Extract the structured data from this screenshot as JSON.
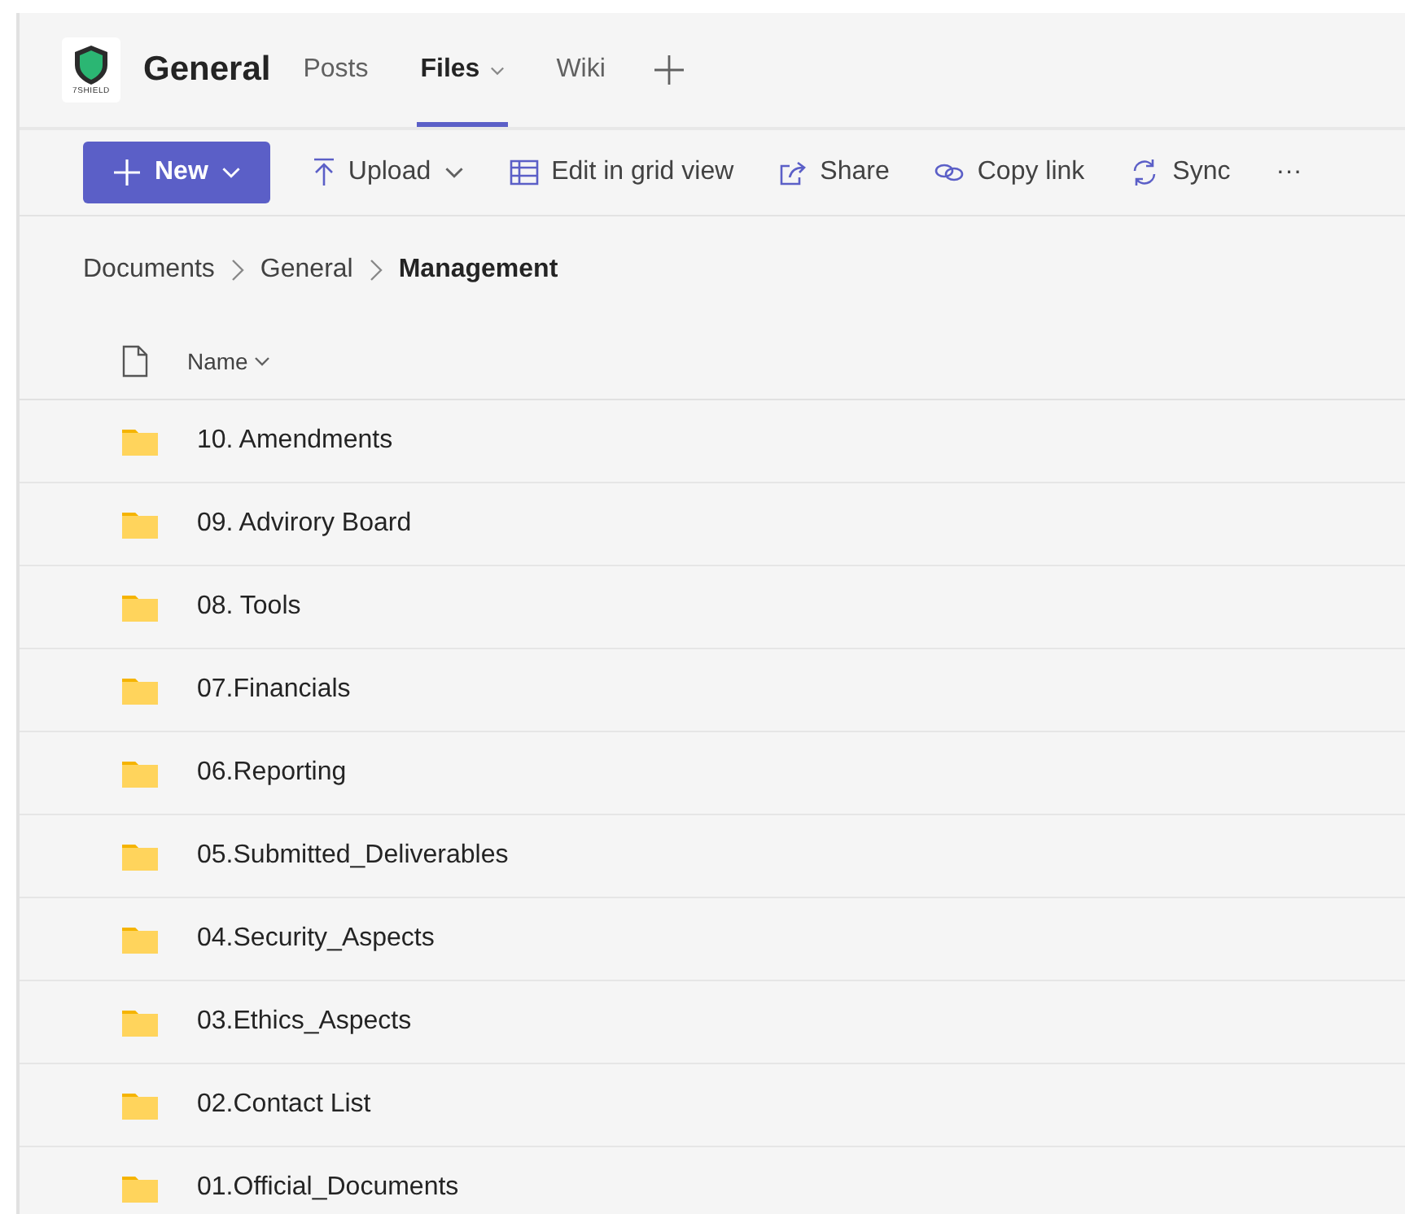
{
  "header": {
    "logo_text": "7SHIELD",
    "title": "General",
    "tabs": [
      {
        "label": "Posts",
        "selected": false,
        "has_menu": false
      },
      {
        "label": "Files",
        "selected": true,
        "has_menu": true
      },
      {
        "label": "Wiki",
        "selected": false,
        "has_menu": false
      }
    ]
  },
  "toolbar": [
    {
      "kind": "primary",
      "label": "New",
      "has_menu": true
    },
    {
      "kind": "action",
      "label": "Upload",
      "has_menu": true
    },
    {
      "kind": "action",
      "label": "Edit in grid view",
      "has_menu": false
    },
    {
      "kind": "action",
      "label": "Share",
      "has_menu": false
    },
    {
      "kind": "action",
      "label": "Copy link",
      "has_menu": false
    },
    {
      "kind": "action",
      "label": "Sync",
      "has_menu": false
    },
    {
      "kind": "more",
      "label": "···",
      "has_menu": false
    }
  ],
  "breadcrumb": [
    "Documents",
    "General",
    "Management"
  ],
  "table": {
    "columns": [
      "Name"
    ],
    "rows": [
      {
        "name": "10. Amendments"
      },
      {
        "name": "09. Advirory Board"
      },
      {
        "name": "08. Tools"
      },
      {
        "name": "07.Financials"
      },
      {
        "name": "06.Reporting"
      },
      {
        "name": "05.Submitted_Deliverables"
      },
      {
        "name": "04.Security_Aspects"
      },
      {
        "name": "03.Ethics_Aspects"
      },
      {
        "name": "02.Contact List"
      },
      {
        "name": "01.Official_Documents"
      }
    ]
  }
}
